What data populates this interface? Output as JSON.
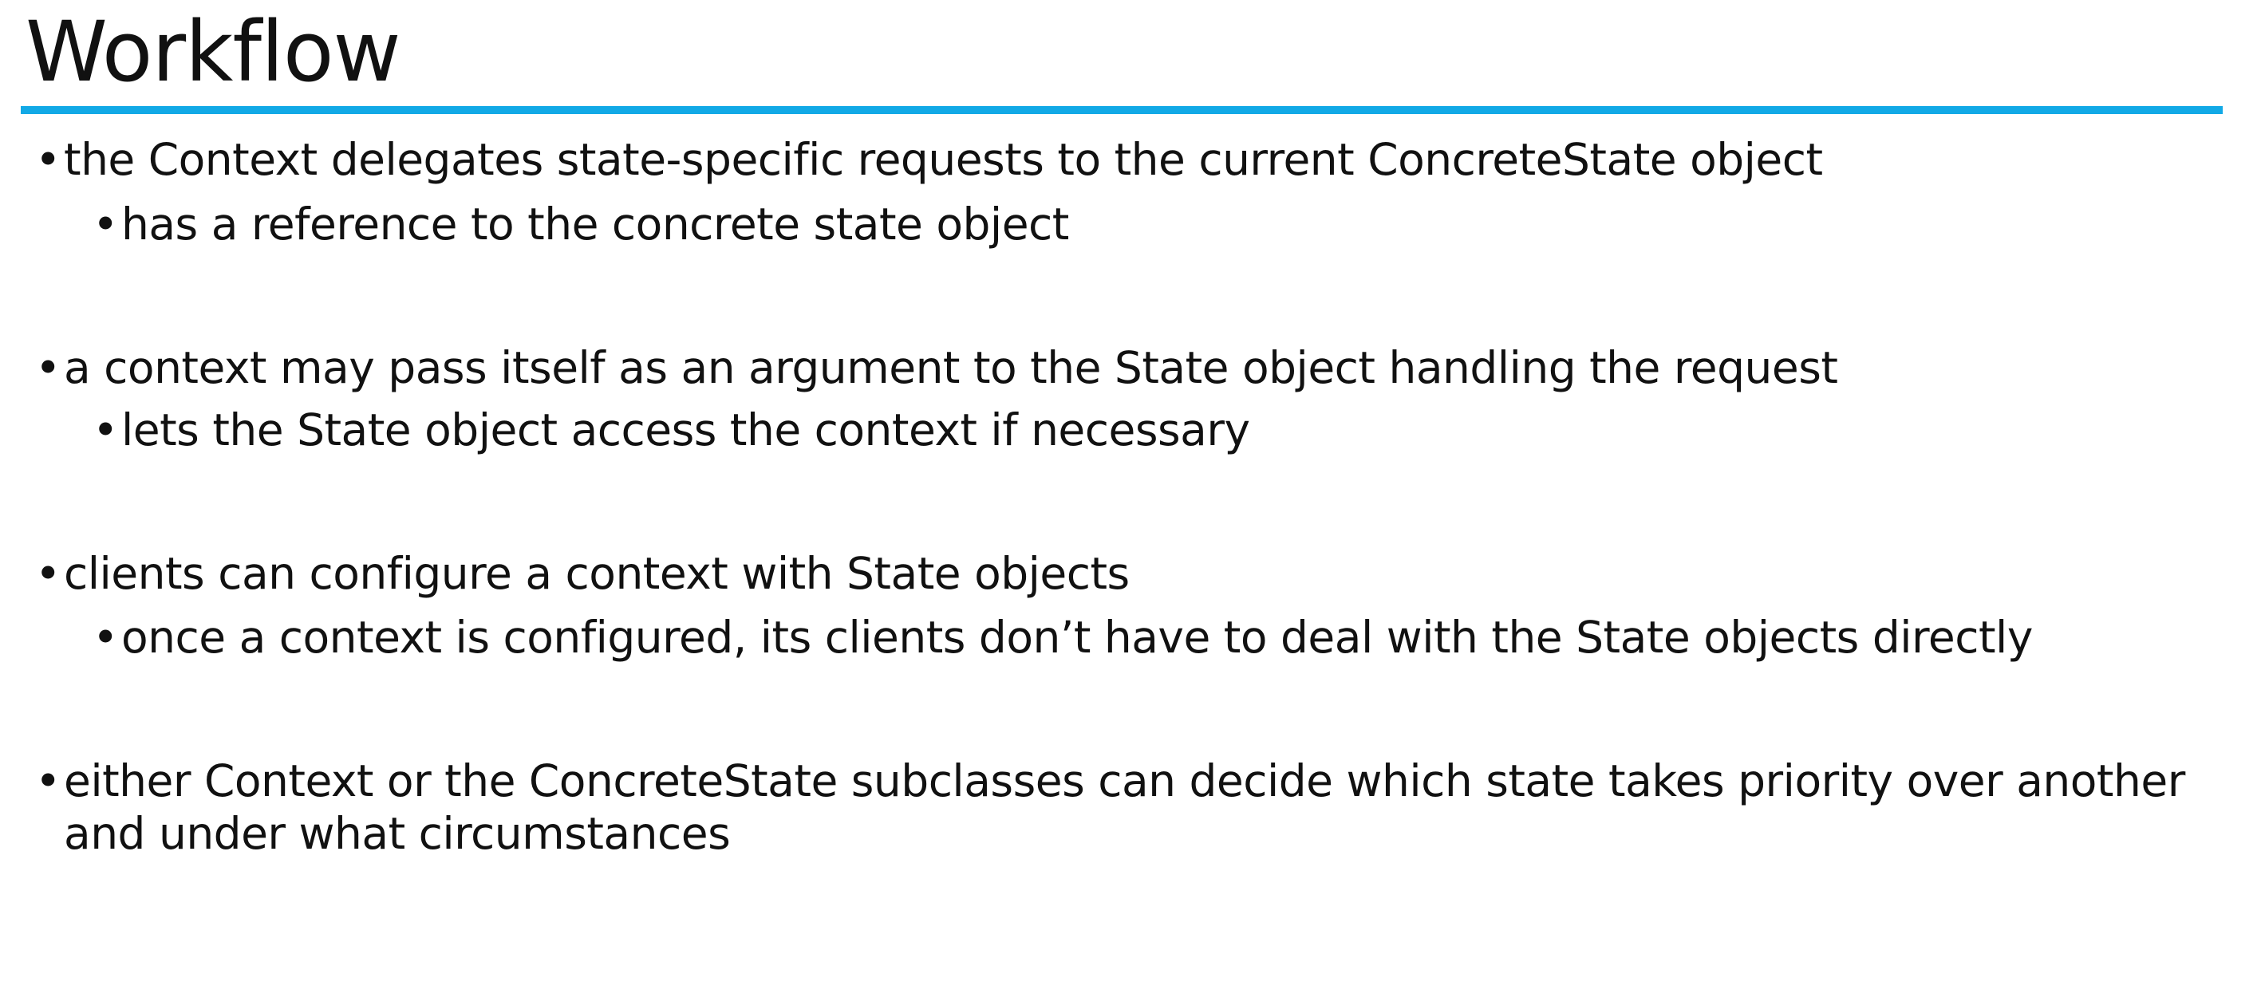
{
  "slide": {
    "title": "Workflow",
    "accent_color": "#12a9e6",
    "bullet_glyph": "•",
    "groups": [
      {
        "text": "the Context delegates state-specific requests to the current ConcreteState object",
        "sub": "has a reference to the concrete state object"
      },
      {
        "text": "a context may pass itself as an argument to the State object handling the request",
        "sub": "lets the State object access the context if necessary"
      },
      {
        "text": "clients can configure a context with State objects",
        "sub": "once a context is configured, its clients don’t have to deal with the State objects directly"
      },
      {
        "text": "either Context or the ConcreteState subclasses can decide which state takes priority over another and under what circumstances",
        "sub": ""
      }
    ]
  }
}
